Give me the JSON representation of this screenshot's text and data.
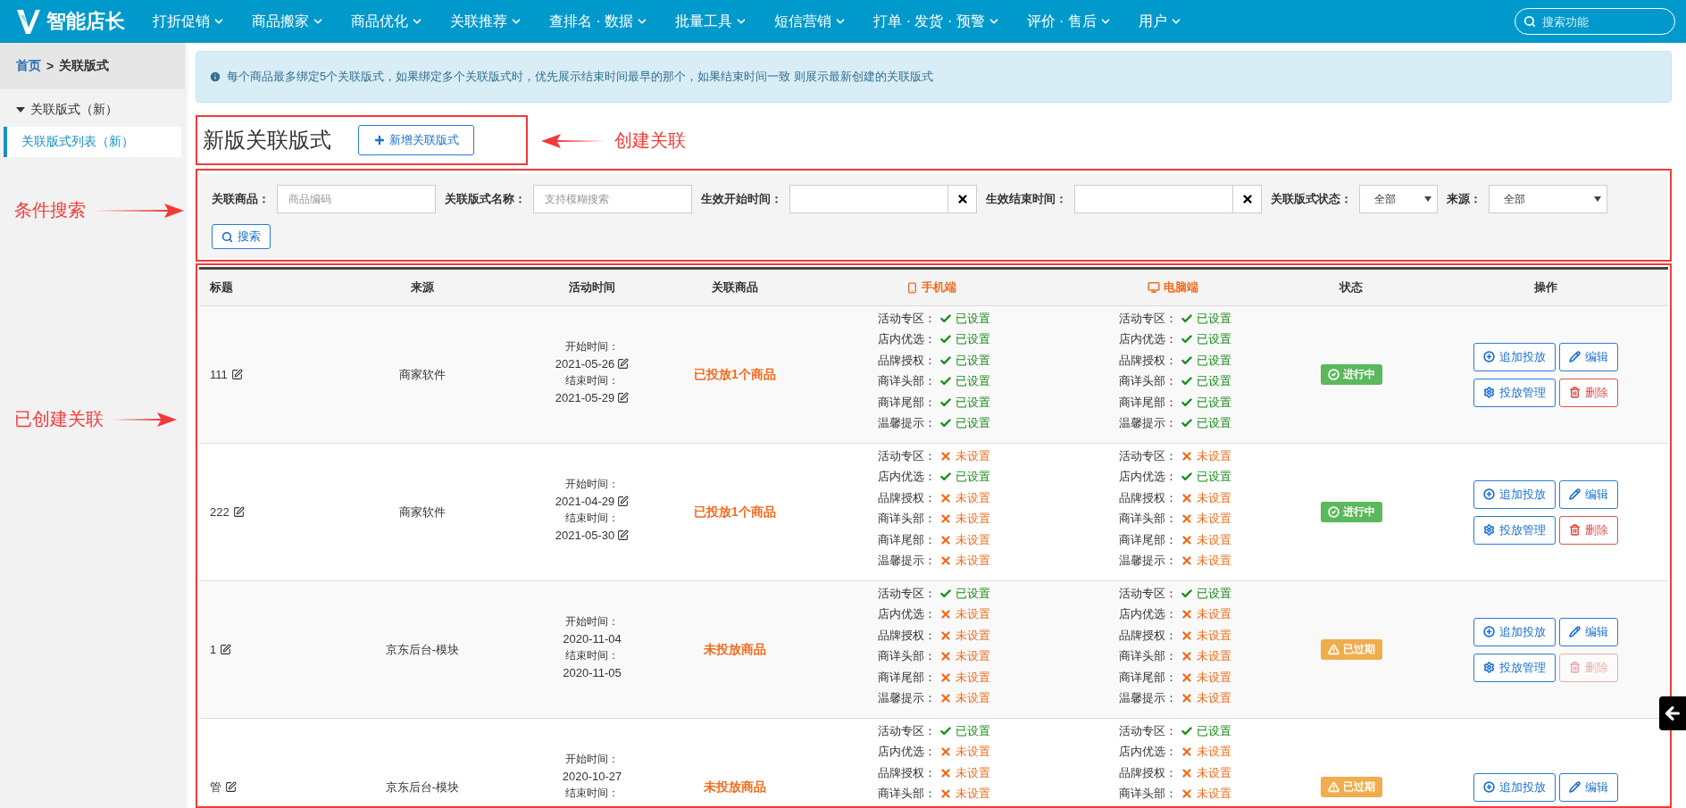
{
  "navbar": {
    "logo": "智能店长",
    "menus": [
      {
        "label": "打折促销"
      },
      {
        "label": "商品搬家"
      },
      {
        "label": "商品优化"
      },
      {
        "label": "关联推荐"
      },
      {
        "label": "查排名 · 数据"
      },
      {
        "label": "批量工具"
      },
      {
        "label": "短信营销"
      },
      {
        "label": "打单 · 发货 · 预警"
      },
      {
        "label": "评价 · 售后"
      },
      {
        "label": "用户"
      }
    ],
    "search": {
      "placeholder": "搜索功能"
    }
  },
  "sidebar": {
    "breadcrumb": {
      "home": "首页",
      "separator": ">",
      "current": "关联版式"
    },
    "tree": [
      {
        "label": "关联版式（新）",
        "expanded": true,
        "children": [
          {
            "label": "关联版式列表（新）",
            "selected": true
          }
        ]
      }
    ]
  },
  "notice": "每个商品最多绑定5个关联版式，如果绑定多个关联版式时，优先展示结束时间最早的那个，如果结束时间一致 则展示最新创建的关联版式",
  "page_title": "新版关联版式",
  "create_button": "新增关联版式",
  "filters": [
    {
      "kind": "text",
      "label": "关联商品：",
      "placeholder": "商品编码"
    },
    {
      "kind": "text",
      "label": "关联版式名称：",
      "placeholder": "支持模糊搜索"
    },
    {
      "kind": "date",
      "label": "生效开始时间："
    },
    {
      "kind": "date",
      "label": "生效结束时间："
    },
    {
      "kind": "select",
      "label": "关联版式状态：",
      "value": "全部"
    },
    {
      "kind": "select",
      "label": "来源：",
      "value": "全部"
    }
  ],
  "search_button": "搜索",
  "table": {
    "columns": [
      {
        "label": "标题",
        "kind": "plain"
      },
      {
        "label": "来源",
        "kind": "plain"
      },
      {
        "label": "活动时间",
        "kind": "plain"
      },
      {
        "label": "关联商品",
        "kind": "plain"
      },
      {
        "label": "手机端",
        "kind": "mobile"
      },
      {
        "label": "电脑端",
        "kind": "desktop"
      },
      {
        "label": "状态",
        "kind": "plain"
      },
      {
        "label": "操作",
        "kind": "plain"
      }
    ],
    "rows": [
      {
        "title": "111",
        "source": "商家软件",
        "start_label": "开始时间：",
        "start": "2021-05-26",
        "end_label": "结束时间：",
        "end": "2021-05-29",
        "dates_editable": true,
        "products": "已投放1个商品",
        "mobile": [
          {
            "label": "活动专区：",
            "set": true,
            "value": "已设置"
          },
          {
            "label": "店内优选：",
            "set": true,
            "value": "已设置"
          },
          {
            "label": "品牌授权：",
            "set": true,
            "value": "已设置"
          },
          {
            "label": "商详头部：",
            "set": true,
            "value": "已设置"
          },
          {
            "label": "商详尾部：",
            "set": true,
            "value": "已设置"
          },
          {
            "label": "温馨提示：",
            "set": true,
            "value": "已设置"
          }
        ],
        "desktop": [
          {
            "label": "活动专区：",
            "set": true,
            "value": "已设置"
          },
          {
            "label": "店内优选：",
            "set": true,
            "value": "已设置"
          },
          {
            "label": "品牌授权：",
            "set": true,
            "value": "已设置"
          },
          {
            "label": "商详头部：",
            "set": true,
            "value": "已设置"
          },
          {
            "label": "商详尾部：",
            "set": true,
            "value": "已设置"
          },
          {
            "label": "温馨提示：",
            "set": true,
            "value": "已设置"
          }
        ],
        "status": {
          "kind": "running",
          "label": "进行中"
        },
        "actions": [
          {
            "kind": "add",
            "label": "追加投放",
            "disabled": false
          },
          {
            "kind": "edit",
            "label": "编辑",
            "disabled": false
          },
          {
            "kind": "manage",
            "label": "投放管理",
            "disabled": false
          },
          {
            "kind": "delete",
            "label": "删除",
            "disabled": false
          }
        ]
      },
      {
        "title": "222",
        "source": "商家软件",
        "start_label": "开始时间：",
        "start": "2021-04-29",
        "end_label": "结束时间：",
        "end": "2021-05-30",
        "dates_editable": true,
        "products": "已投放1个商品",
        "mobile": [
          {
            "label": "活动专区：",
            "set": false,
            "value": "未设置"
          },
          {
            "label": "店内优选：",
            "set": true,
            "value": "已设置"
          },
          {
            "label": "品牌授权：",
            "set": false,
            "value": "未设置"
          },
          {
            "label": "商详头部：",
            "set": false,
            "value": "未设置"
          },
          {
            "label": "商详尾部：",
            "set": false,
            "value": "未设置"
          },
          {
            "label": "温馨提示：",
            "set": false,
            "value": "未设置"
          }
        ],
        "desktop": [
          {
            "label": "活动专区：",
            "set": false,
            "value": "未设置"
          },
          {
            "label": "店内优选：",
            "set": true,
            "value": "已设置"
          },
          {
            "label": "品牌授权：",
            "set": false,
            "value": "未设置"
          },
          {
            "label": "商详头部：",
            "set": false,
            "value": "未设置"
          },
          {
            "label": "商详尾部：",
            "set": false,
            "value": "未设置"
          },
          {
            "label": "温馨提示：",
            "set": false,
            "value": "未设置"
          }
        ],
        "status": {
          "kind": "running",
          "label": "进行中"
        },
        "actions": [
          {
            "kind": "add",
            "label": "追加投放",
            "disabled": false
          },
          {
            "kind": "edit",
            "label": "编辑",
            "disabled": false
          },
          {
            "kind": "manage",
            "label": "投放管理",
            "disabled": false
          },
          {
            "kind": "delete",
            "label": "删除",
            "disabled": false
          }
        ]
      },
      {
        "title": "1",
        "source": "京东后台-模块",
        "start_label": "开始时间：",
        "start": "2020-11-04",
        "end_label": "结束时间：",
        "end": "2020-11-05",
        "dates_editable": false,
        "products": "未投放商品",
        "mobile": [
          {
            "label": "活动专区：",
            "set": true,
            "value": "已设置"
          },
          {
            "label": "店内优选：",
            "set": false,
            "value": "未设置"
          },
          {
            "label": "品牌授权：",
            "set": false,
            "value": "未设置"
          },
          {
            "label": "商详头部：",
            "set": false,
            "value": "未设置"
          },
          {
            "label": "商详尾部：",
            "set": false,
            "value": "未设置"
          },
          {
            "label": "温馨提示：",
            "set": false,
            "value": "未设置"
          }
        ],
        "desktop": [
          {
            "label": "活动专区：",
            "set": true,
            "value": "已设置"
          },
          {
            "label": "店内优选：",
            "set": false,
            "value": "未设置"
          },
          {
            "label": "品牌授权：",
            "set": false,
            "value": "未设置"
          },
          {
            "label": "商详头部：",
            "set": false,
            "value": "未设置"
          },
          {
            "label": "商详尾部：",
            "set": false,
            "value": "未设置"
          },
          {
            "label": "温馨提示：",
            "set": false,
            "value": "未设置"
          }
        ],
        "status": {
          "kind": "expired",
          "label": "已过期"
        },
        "actions": [
          {
            "kind": "add",
            "label": "追加投放",
            "disabled": false
          },
          {
            "kind": "edit",
            "label": "编辑",
            "disabled": false
          },
          {
            "kind": "manage",
            "label": "投放管理",
            "disabled": false
          },
          {
            "kind": "delete",
            "label": "删除",
            "disabled": true
          }
        ]
      },
      {
        "title": "管",
        "source": "京东后台-模块",
        "start_label": "开始时间：",
        "start": "2020-10-27",
        "end_label": "结束时间：",
        "dates_editable": false,
        "products": "未投放商品",
        "mobile": [
          {
            "label": "活动专区：",
            "set": true,
            "value": "已设置"
          },
          {
            "label": "店内优选：",
            "set": false,
            "value": "未设置"
          },
          {
            "label": "品牌授权：",
            "set": false,
            "value": "未设置"
          },
          {
            "label": "商详头部：",
            "set": false,
            "value": "未设置"
          }
        ],
        "desktop": [
          {
            "label": "活动专区：",
            "set": true,
            "value": "已设置"
          },
          {
            "label": "店内优选：",
            "set": false,
            "value": "未设置"
          },
          {
            "label": "品牌授权：",
            "set": false,
            "value": "未设置"
          },
          {
            "label": "商详头部：",
            "set": false,
            "value": "未设置"
          }
        ],
        "status": {
          "kind": "expired",
          "label": "已过期"
        },
        "actions": [
          {
            "kind": "add",
            "label": "追加投放",
            "disabled": false
          },
          {
            "kind": "edit",
            "label": "编辑",
            "disabled": false
          }
        ]
      }
    ]
  },
  "annotations": [
    {
      "kind": "header",
      "text": "创建关联"
    },
    {
      "kind": "filters",
      "text": "条件搜索"
    },
    {
      "kind": "table",
      "text": "已创建关联"
    }
  ]
}
